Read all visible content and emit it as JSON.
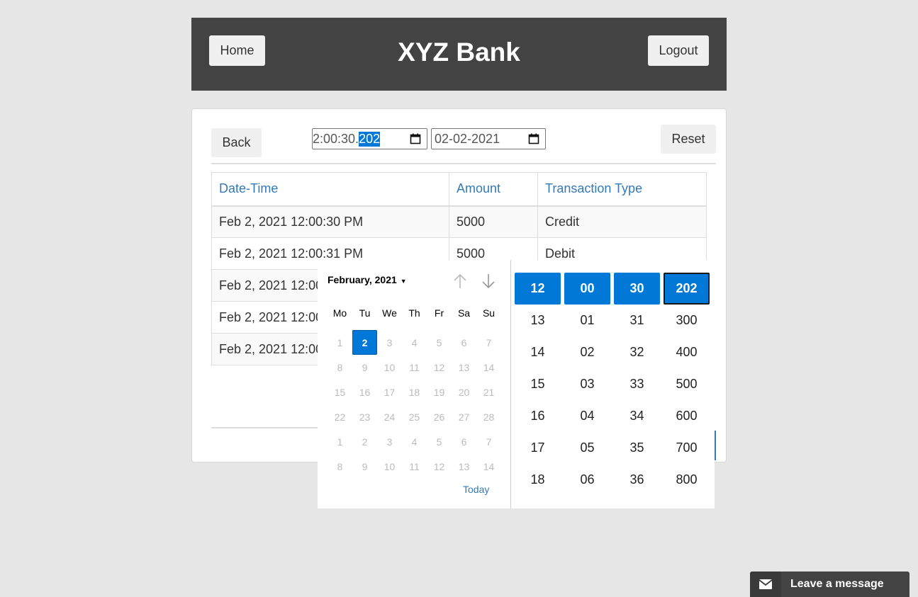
{
  "header": {
    "home_label": "Home",
    "title": "XYZ Bank",
    "logout_label": "Logout"
  },
  "toolbar": {
    "back_label": "Back",
    "reset_label": "Reset",
    "from_value_prefix": "2:00:30.",
    "from_value_selected": "202",
    "to_value": "02-02-2021"
  },
  "table": {
    "headers": [
      "Date-Time",
      "Amount",
      "Transaction Type"
    ],
    "rows": [
      [
        "Feb 2, 2021 12:00:30 PM",
        "5000",
        "Credit"
      ],
      [
        "Feb 2, 2021 12:00:31 PM",
        "5000",
        "Debit"
      ],
      [
        "Feb 2, 2021 12:00",
        "",
        ""
      ],
      [
        "Feb 2, 2021 12:00",
        "",
        ""
      ],
      [
        "Feb 2, 2021 12:00",
        "",
        ""
      ]
    ]
  },
  "picker": {
    "month_label": "February, 2021",
    "weekdays": [
      "Mo",
      "Tu",
      "We",
      "Th",
      "Fr",
      "Sa",
      "Su"
    ],
    "days": [
      [
        "1",
        "2",
        "3",
        "4",
        "5",
        "6",
        "7"
      ],
      [
        "8",
        "9",
        "10",
        "11",
        "12",
        "13",
        "14"
      ],
      [
        "15",
        "16",
        "17",
        "18",
        "19",
        "20",
        "21"
      ],
      [
        "22",
        "23",
        "24",
        "25",
        "26",
        "27",
        "28"
      ],
      [
        "1",
        "2",
        "3",
        "4",
        "5",
        "6",
        "7"
      ],
      [
        "8",
        "9",
        "10",
        "11",
        "12",
        "13",
        "14"
      ]
    ],
    "selected_day": "2",
    "today_label": "Today",
    "time_columns": [
      [
        "12",
        "13",
        "14",
        "15",
        "16",
        "17",
        "18"
      ],
      [
        "00",
        "01",
        "02",
        "03",
        "04",
        "05",
        "06"
      ],
      [
        "30",
        "31",
        "32",
        "33",
        "34",
        "35",
        "36"
      ],
      [
        "202",
        "300",
        "400",
        "500",
        "600",
        "700",
        "800"
      ]
    ]
  },
  "chat": {
    "label": "Leave a message",
    "icon": "envelope-icon"
  },
  "colors": {
    "accent": "#0078d7",
    "header_bg": "#434343",
    "link": "#337ab7",
    "page_bg": "#e6e6e6"
  }
}
